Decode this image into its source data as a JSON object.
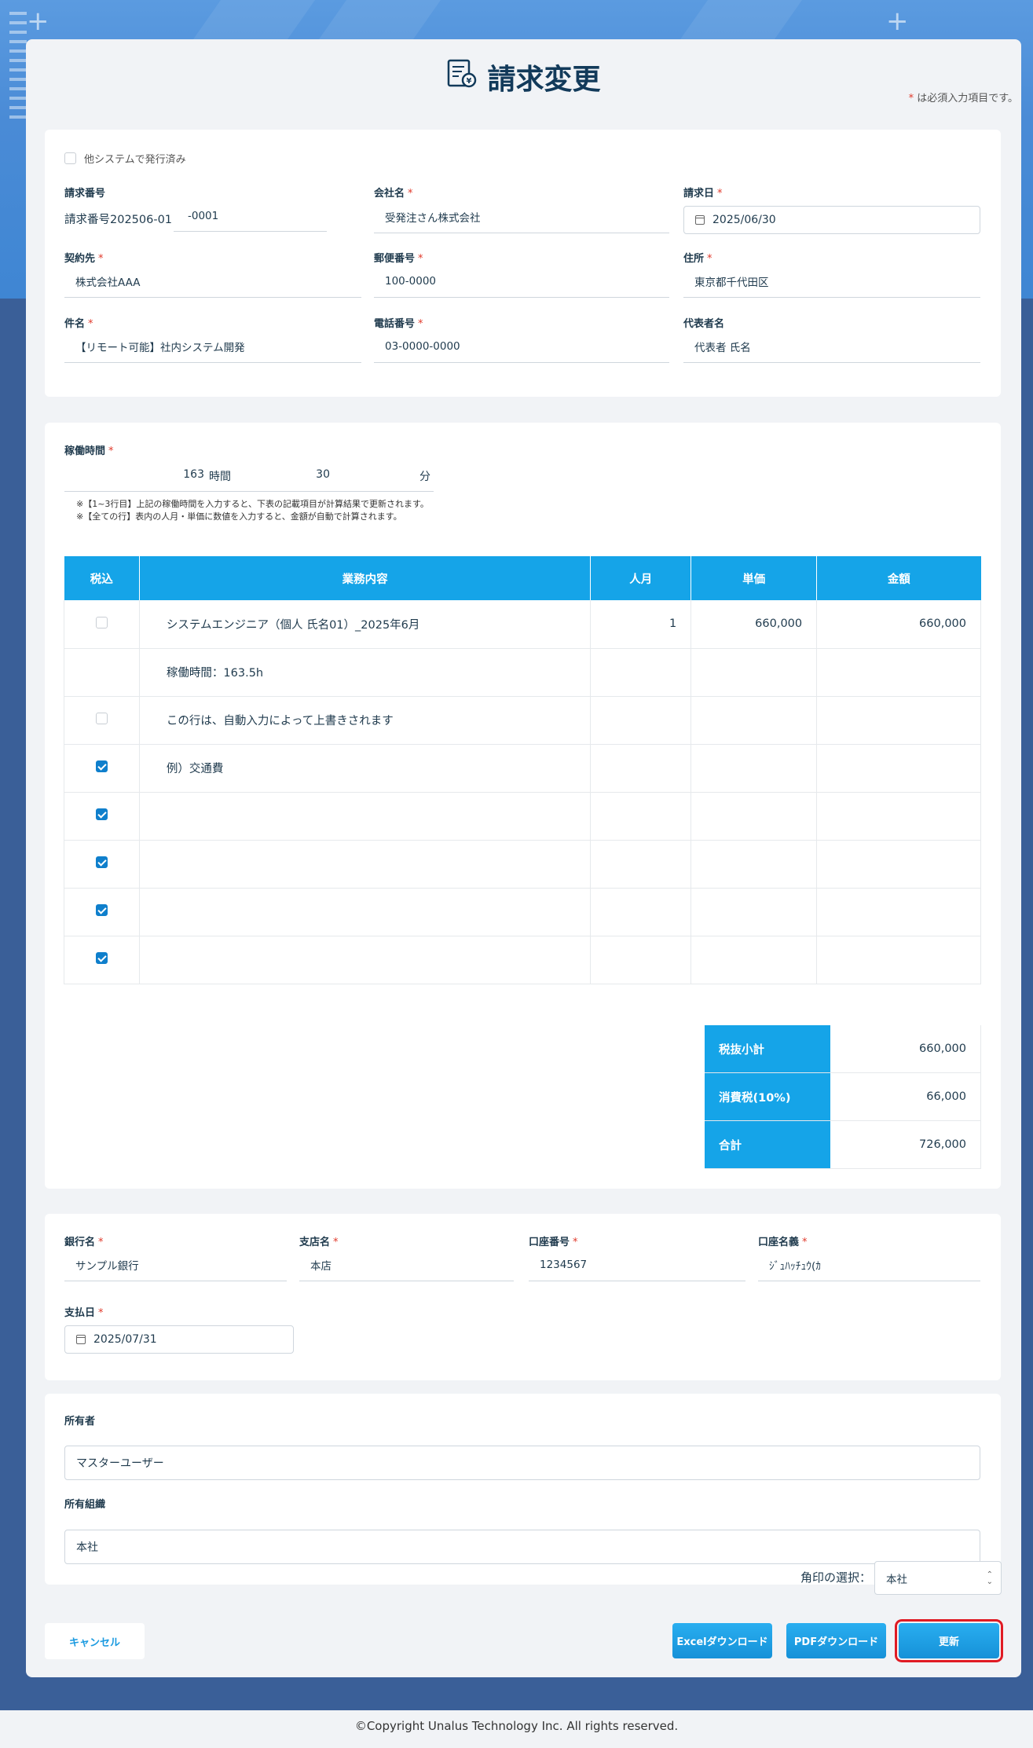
{
  "page": {
    "title": "請求変更",
    "required_note": "は必須入力項目です。",
    "required_mark": "*"
  },
  "basic": {
    "issued_other_label": "他システムで発行済み",
    "invoice_no_label": "請求番号",
    "invoice_no_prefix": "請求番号202506-01",
    "invoice_no_suffix": "-0001",
    "company_label": "会社名",
    "company_value": "受発注さん株式会社",
    "invoice_date_label": "請求日",
    "invoice_date_value": "2025/06/30",
    "contractor_label": "契約先",
    "contractor_value": "株式会社AAA",
    "postal_label": "郵便番号",
    "postal_value": "100-0000",
    "address_label": "住所",
    "address_value": "東京都千代田区",
    "subject_label": "件名",
    "subject_value": "【リモート可能】社内システム開発",
    "phone_label": "電話番号",
    "phone_value": "03-0000-0000",
    "rep_label": "代表者名",
    "rep_value": "代表者 氏名"
  },
  "work": {
    "hours_label": "稼働時間",
    "hours_value": "163",
    "hours_unit": "時間",
    "minutes_value": "30",
    "minutes_unit": "分",
    "note1": "※【1~3行目】上記の稼働時間を入力すると、下表の記載項目が計算結果で更新されます。",
    "note2": "※【全ての行】表内の人月・単価に数値を入力すると、金額が自動で計算されます。"
  },
  "table": {
    "headers": [
      "税込",
      "業務内容",
      "人月",
      "単価",
      "金額"
    ],
    "rows": [
      {
        "tax": false,
        "desc": "システムエンジニア（個人 氏名01）_2025年6月",
        "qty": "1",
        "price": "660,000",
        "amount": "660,000",
        "show_check": true,
        "placeholder": false
      },
      {
        "tax": false,
        "desc": "稼働時間：163.5h",
        "qty": "",
        "price": "",
        "amount": "",
        "show_check": false,
        "placeholder": false
      },
      {
        "tax": false,
        "desc": "この行は、自動入力によって上書きされます",
        "qty": "",
        "price": "",
        "amount": "",
        "show_check": true,
        "placeholder": true
      },
      {
        "tax": true,
        "desc": "例）交通費",
        "qty": "",
        "price": "",
        "amount": "",
        "show_check": true,
        "placeholder": true
      },
      {
        "tax": true,
        "desc": "",
        "qty": "",
        "price": "",
        "amount": "",
        "show_check": true,
        "placeholder": false
      },
      {
        "tax": true,
        "desc": "",
        "qty": "",
        "price": "",
        "amount": "",
        "show_check": true,
        "placeholder": false
      },
      {
        "tax": true,
        "desc": "",
        "qty": "",
        "price": "",
        "amount": "",
        "show_check": true,
        "placeholder": false
      },
      {
        "tax": true,
        "desc": "",
        "qty": "",
        "price": "",
        "amount": "",
        "show_check": true,
        "placeholder": false
      }
    ],
    "subtotal_label": "税抜小計",
    "subtotal_value": "660,000",
    "tax_label": "消費税(10%)",
    "tax_value": "66,000",
    "total_label": "合計",
    "total_value": "726,000"
  },
  "bank": {
    "bank_label": "銀行名",
    "bank_value": "サンプル銀行",
    "branch_label": "支店名",
    "branch_value": "本店",
    "account_no_label": "口座番号",
    "account_no_value": "1234567",
    "account_name_label": "口座名義",
    "account_name_value": "ｼﾞｭﾊｯﾁｭｳ(ｶ",
    "pay_date_label": "支払日",
    "pay_date_value": "2025/07/31"
  },
  "owner": {
    "owner_label": "所有者",
    "owner_value": "マスターユーザー",
    "org_label": "所有組織",
    "org_value": "本社"
  },
  "actions": {
    "seal_label": "角印の選択：",
    "seal_value": "本社",
    "cancel": "キャンセル",
    "excel": "Excelダウンロード",
    "pdf": "PDFダウンロード",
    "update": "更新"
  },
  "footer": "©Copyright Unalus Technology Inc. All rights reserved.",
  "colors": {
    "accent": "#15a4e8",
    "required": "#e0392b",
    "highlight": "#e01b24",
    "background": "#3a5f98"
  }
}
